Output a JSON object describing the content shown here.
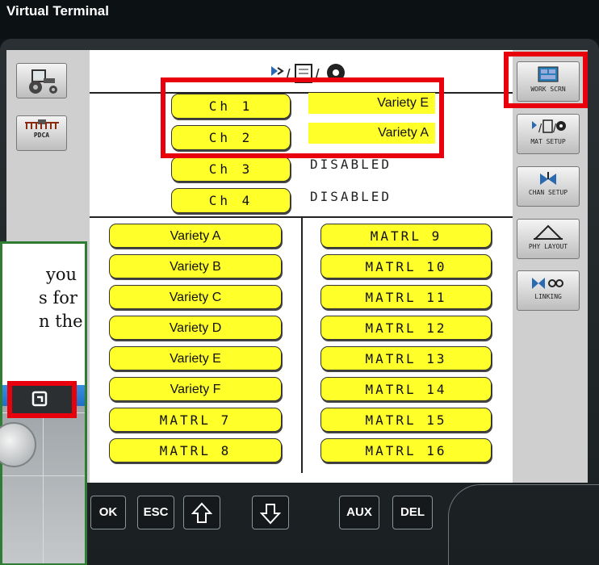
{
  "window": {
    "title": "Virtual Terminal"
  },
  "left_sidebar": {
    "pdca_label": "PDCA"
  },
  "right_sidebar": {
    "buttons": [
      {
        "label": "WORK SCRN"
      },
      {
        "label": "MAT SETUP"
      },
      {
        "label": "CHAN SETUP"
      },
      {
        "label": "PHY LAYOUT"
      },
      {
        "label": "LINKING"
      }
    ]
  },
  "channels": [
    {
      "label": "Ch 1",
      "value": "Variety E"
    },
    {
      "label": "Ch 2",
      "value": "Variety A"
    },
    {
      "label": "Ch 3",
      "value": "DISABLED"
    },
    {
      "label": "Ch 4",
      "value": "DISABLED"
    }
  ],
  "materials_left": [
    "Variety A",
    "Variety B",
    "Variety C",
    "Variety D",
    "Variety E",
    "Variety F",
    "MATRL 7",
    "MATRL 8"
  ],
  "materials_right": [
    "MATRL 9",
    "MATRL 10",
    "MATRL 11",
    "MATRL 12",
    "MATRL 13",
    "MATRL 14",
    "MATRL 15",
    "MATRL 16"
  ],
  "softkeys": [
    "OK",
    "ESC",
    "AUX",
    "DEL"
  ],
  "callout": {
    "lines": [
      "you",
      "s for",
      "n the"
    ]
  },
  "colors": {
    "highlight_red": "#e8000d",
    "button_yellow": "#ffff2a",
    "callout_green": "#2f7d32"
  }
}
